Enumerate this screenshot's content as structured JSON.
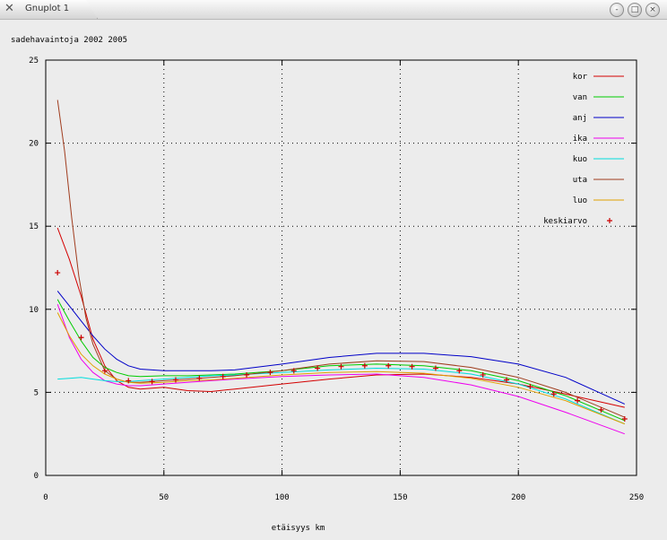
{
  "window": {
    "title": "Gnuplot 1",
    "app_icon": "x-icon",
    "buttons": [
      {
        "name": "minimize-button",
        "glyph": "-"
      },
      {
        "name": "maximize-button",
        "glyph": "□"
      },
      {
        "name": "close-button",
        "glyph": "×"
      }
    ]
  },
  "chart_data": {
    "type": "line",
    "title": "sadehavaintoja 2002 2005",
    "xlabel": "etäisyys km",
    "ylabel": "",
    "xlim": [
      0,
      250
    ],
    "ylim": [
      0,
      25
    ],
    "xticks": [
      0,
      50,
      100,
      150,
      200,
      250
    ],
    "yticks": [
      0,
      5,
      10,
      15,
      20,
      25
    ],
    "grid": true,
    "legend_position": "top-right",
    "series": [
      {
        "name": "kor",
        "color": "#d40000",
        "style": "line",
        "x": [
          5,
          10,
          15,
          20,
          25,
          30,
          35,
          40,
          50,
          60,
          70,
          80,
          100,
          120,
          140,
          160,
          180,
          200,
          220,
          245
        ],
        "y": [
          14.9,
          13,
          10.8,
          8.2,
          6.6,
          5.7,
          5.3,
          5.2,
          5.3,
          5.1,
          5.05,
          5.2,
          5.5,
          5.8,
          6.05,
          6.1,
          5.9,
          5.5,
          4.9,
          4.1
        ]
      },
      {
        "name": "van",
        "color": "#00cc00",
        "style": "line",
        "x": [
          5,
          10,
          15,
          20,
          25,
          30,
          35,
          40,
          50,
          60,
          70,
          80,
          100,
          120,
          140,
          160,
          180,
          200,
          220,
          245
        ],
        "y": [
          10.6,
          9.3,
          8.1,
          7.1,
          6.5,
          6.2,
          6.0,
          5.95,
          6.0,
          6.0,
          6.05,
          6.1,
          6.3,
          6.6,
          6.7,
          6.6,
          6.3,
          5.7,
          4.8,
          3.3
        ]
      },
      {
        "name": "anj",
        "color": "#0000c8",
        "style": "line",
        "x": [
          5,
          10,
          15,
          20,
          25,
          30,
          35,
          40,
          50,
          60,
          70,
          80,
          100,
          120,
          140,
          160,
          180,
          200,
          220,
          245
        ],
        "y": [
          11.1,
          10.2,
          9.3,
          8.4,
          7.6,
          7.0,
          6.6,
          6.4,
          6.3,
          6.3,
          6.3,
          6.35,
          6.7,
          7.1,
          7.35,
          7.35,
          7.15,
          6.7,
          5.9,
          4.3
        ]
      },
      {
        "name": "ika",
        "color": "#ee00ee",
        "style": "line",
        "x": [
          5,
          10,
          15,
          20,
          25,
          30,
          35,
          40,
          50,
          60,
          70,
          80,
          100,
          120,
          140,
          160,
          180,
          200,
          220,
          245
        ],
        "y": [
          10.3,
          8.3,
          7.0,
          6.2,
          5.7,
          5.5,
          5.4,
          5.4,
          5.5,
          5.6,
          5.7,
          5.8,
          5.95,
          6.05,
          6.1,
          5.9,
          5.45,
          4.75,
          3.8,
          2.5
        ]
      },
      {
        "name": "kuo",
        "color": "#00dddd",
        "style": "line",
        "x": [
          5,
          10,
          15,
          20,
          25,
          30,
          35,
          40,
          50,
          60,
          70,
          80,
          100,
          120,
          140,
          160,
          180,
          200,
          220,
          245
        ],
        "y": [
          5.8,
          5.85,
          5.9,
          5.8,
          5.7,
          5.65,
          5.65,
          5.7,
          5.8,
          5.9,
          6.0,
          6.05,
          6.2,
          6.35,
          6.45,
          6.4,
          6.1,
          5.5,
          4.6,
          3.1
        ]
      },
      {
        "name": "uta",
        "color": "#a03c1e",
        "style": "line",
        "x": [
          5,
          8,
          11,
          14,
          17,
          20,
          25,
          30,
          35,
          40,
          50,
          60,
          70,
          80,
          100,
          120,
          140,
          160,
          180,
          200,
          220,
          245
        ],
        "y": [
          22.6,
          19.5,
          15.5,
          12.0,
          9.5,
          7.9,
          6.3,
          5.8,
          5.6,
          5.6,
          5.7,
          5.8,
          5.9,
          6.0,
          6.3,
          6.7,
          6.9,
          6.85,
          6.5,
          5.9,
          5.0,
          3.5
        ]
      },
      {
        "name": "luo",
        "color": "#e0a000",
        "style": "line",
        "x": [
          5,
          10,
          15,
          20,
          25,
          30,
          35,
          40,
          50,
          60,
          70,
          80,
          100,
          120,
          140,
          160,
          180,
          200,
          220,
          245
        ],
        "y": [
          9.8,
          8.4,
          7.3,
          6.6,
          6.1,
          5.8,
          5.6,
          5.55,
          5.6,
          5.7,
          5.75,
          5.85,
          6.05,
          6.2,
          6.25,
          6.15,
          5.85,
          5.3,
          4.5,
          3.1
        ]
      },
      {
        "name": "keskiarvo",
        "color": "#cc0000",
        "style": "points",
        "x": [
          5,
          15,
          25,
          35,
          45,
          55,
          65,
          75,
          85,
          95,
          105,
          115,
          125,
          135,
          145,
          155,
          165,
          175,
          185,
          195,
          205,
          215,
          225,
          235,
          245
        ],
        "y": [
          12.2,
          8.3,
          6.3,
          5.7,
          5.65,
          5.75,
          5.85,
          5.95,
          6.05,
          6.2,
          6.3,
          6.45,
          6.55,
          6.6,
          6.6,
          6.55,
          6.45,
          6.3,
          6.05,
          5.75,
          5.35,
          4.9,
          4.5,
          3.95,
          3.4
        ]
      }
    ]
  }
}
